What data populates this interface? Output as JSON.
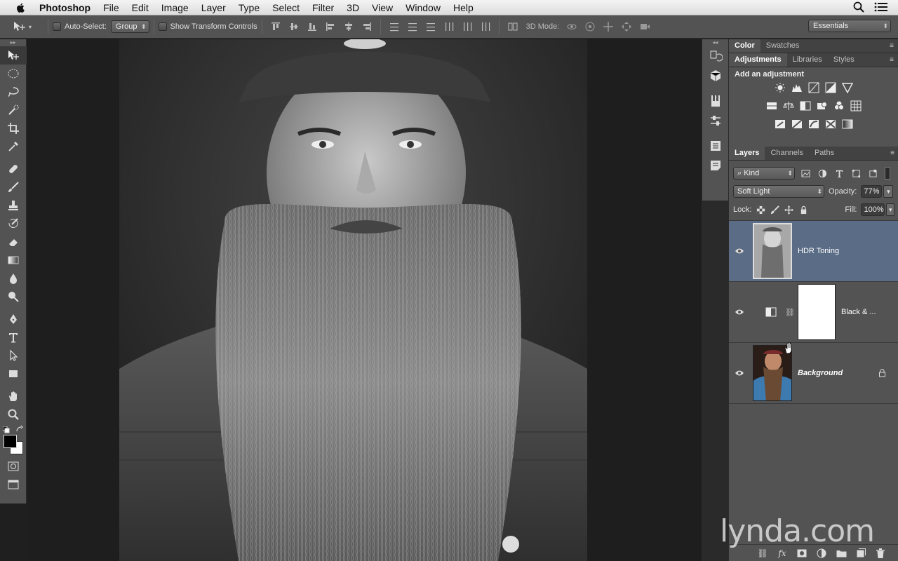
{
  "menubar": {
    "app_name": "Photoshop",
    "items": [
      "File",
      "Edit",
      "Image",
      "Layer",
      "Type",
      "Select",
      "Filter",
      "3D",
      "View",
      "Window",
      "Help"
    ]
  },
  "options_bar": {
    "auto_select_label": "Auto-Select:",
    "auto_select_value": "Group",
    "show_transform_label": "Show Transform Controls",
    "mode_3d_label": "3D Mode:",
    "workspace": "Essentials"
  },
  "panels": {
    "color_tabs": [
      "Color",
      "Swatches"
    ],
    "adjust_tabs": [
      "Adjustments",
      "Libraries",
      "Styles"
    ],
    "adjust_title": "Add an adjustment",
    "layers_tabs": [
      "Layers",
      "Channels",
      "Paths"
    ]
  },
  "layers_panel": {
    "filter_kind": "Kind",
    "blend_mode": "Soft Light",
    "opacity_label": "Opacity:",
    "opacity": "77%",
    "lock_label": "Lock:",
    "fill_label": "Fill:",
    "fill": "100%",
    "layers": [
      {
        "name": "HDR Toning",
        "selected": true
      },
      {
        "name": "Black & ...",
        "selected": false
      },
      {
        "name": "Background",
        "selected": false,
        "locked": true
      }
    ]
  },
  "watermark": "lynda.com",
  "colors": {
    "selection": "#5b6c86",
    "panel": "#535353",
    "canvas_bg": "#1e1e1e"
  }
}
